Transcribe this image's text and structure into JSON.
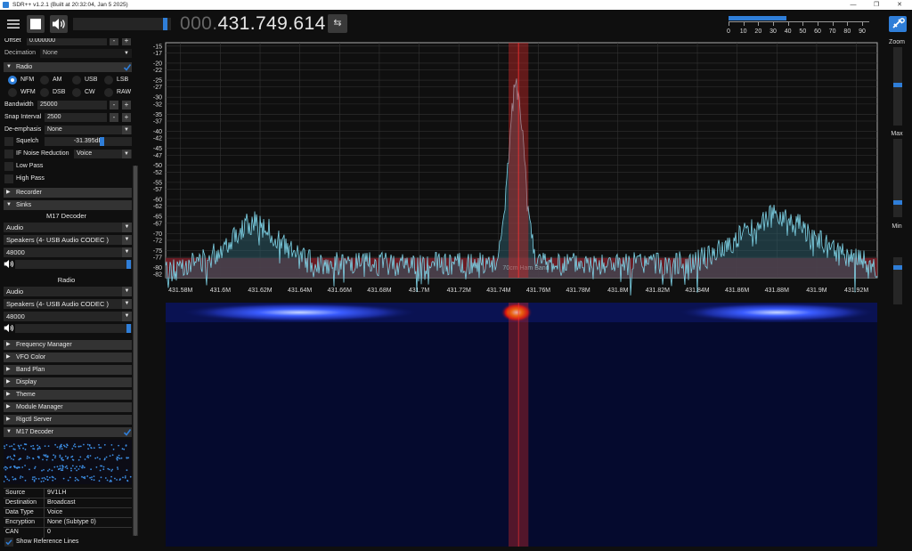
{
  "window": {
    "title": "SDR++ v1.2.1 (Built at 20:32:04, Jan  5 2025)",
    "controls": {
      "minimize": "—",
      "maximize": "❐",
      "close": "✕"
    }
  },
  "toolbar": {
    "frequency_dim": "000.",
    "frequency_main": "431.749.614",
    "swap_glyph": "⇆",
    "volume_level": 0.96,
    "snr_ticks": [
      "0",
      "10",
      "20",
      "30",
      "40",
      "50",
      "60",
      "70",
      "80",
      "90"
    ],
    "snr_level": 39
  },
  "radio": {
    "offset_label": "Offset",
    "offset_value": "0.000000",
    "decimation_label": "Decimation",
    "decimation_value": "None",
    "header": "Radio",
    "modes": [
      "NFM",
      "AM",
      "USB",
      "LSB",
      "WFM",
      "DSB",
      "CW",
      "RAW"
    ],
    "selected_mode": "NFM",
    "bandwidth_label": "Bandwidth",
    "bandwidth_value": "25000",
    "snap_label": "Snap Interval",
    "snap_value": "2500",
    "deemph_label": "De-emphasis",
    "deemph_value": "None",
    "squelch_label": "Squelch",
    "squelch_value": "-31.395dB",
    "ifnr_label": "IF Noise Reduction",
    "ifnr_value": "Voice",
    "lowpass_label": "Low Pass",
    "highpass_label": "High Pass",
    "plus": "+",
    "minus": "-"
  },
  "sections": {
    "recorder": "Recorder",
    "sinks": "Sinks",
    "m17_sink_title": "M17 Decoder",
    "radio_sink_title": "Radio",
    "sink_type": "Audio",
    "sink_device": "Speakers (4- USB Audio CODEC )",
    "sink_rate": "48000",
    "frequency_manager": "Frequency Manager",
    "vfo_color": "VFO Color",
    "band_plan": "Band Plan",
    "display": "Display",
    "theme": "Theme",
    "module_manager": "Module Manager",
    "rigctl_server": "Rigctl Server",
    "m17_decoder": "M17 Decoder"
  },
  "m17": {
    "rows": [
      {
        "k": "Source",
        "v": "9V1LH"
      },
      {
        "k": "Destination",
        "v": "Broadcast"
      },
      {
        "k": "Data Type",
        "v": "Voice"
      },
      {
        "k": "Encryption",
        "v": "None (Subtype 0)"
      },
      {
        "k": "CAN",
        "v": "0"
      }
    ],
    "show_ref_lines": "Show Reference Lines"
  },
  "chart_data": {
    "type": "line",
    "title": "",
    "xlabel": "",
    "ylabel": "",
    "x_ticks": [
      "431.58M",
      "431.6M",
      "431.62M",
      "431.64M",
      "431.66M",
      "431.68M",
      "431.7M",
      "431.72M",
      "431.74M",
      "431.76M",
      "431.78M",
      "431.8M",
      "431.82M",
      "431.84M",
      "431.86M",
      "431.88M",
      "431.9M",
      "431.92M"
    ],
    "y_ticks": [
      "-15",
      "-17",
      "-20",
      "-22",
      "-25",
      "-27",
      "-30",
      "-32",
      "-35",
      "-37",
      "-40",
      "-42",
      "-45",
      "-47",
      "-50",
      "-52",
      "-55",
      "-57",
      "-60",
      "-62",
      "-65",
      "-67",
      "-70",
      "-72",
      "-75",
      "-77",
      "-80",
      "-82"
    ],
    "xlim": [
      431.5725,
      431.9305
    ],
    "ylim": [
      -83,
      -14
    ],
    "vfo_center": 431.75,
    "vfo_bandwidth": 0.01,
    "band_plan_label": "70cm Ham Band",
    "noise_floor": -79,
    "signals": [
      {
        "center": 431.617,
        "peak": -67,
        "width": 0.012
      },
      {
        "center": 431.749,
        "peak": -27,
        "width": 0.004
      },
      {
        "center": 431.88,
        "peak": -65,
        "width": 0.018
      }
    ],
    "grid": true
  },
  "waterfall": {
    "hot_spots": [
      {
        "center": 431.64,
        "width": 0.06
      },
      {
        "center": 431.749,
        "width": 0.008
      },
      {
        "center": 431.88,
        "width": 0.05
      }
    ]
  },
  "right": {
    "zoom_label": "Zoom",
    "max_label": "Max",
    "min_label": "Min"
  }
}
